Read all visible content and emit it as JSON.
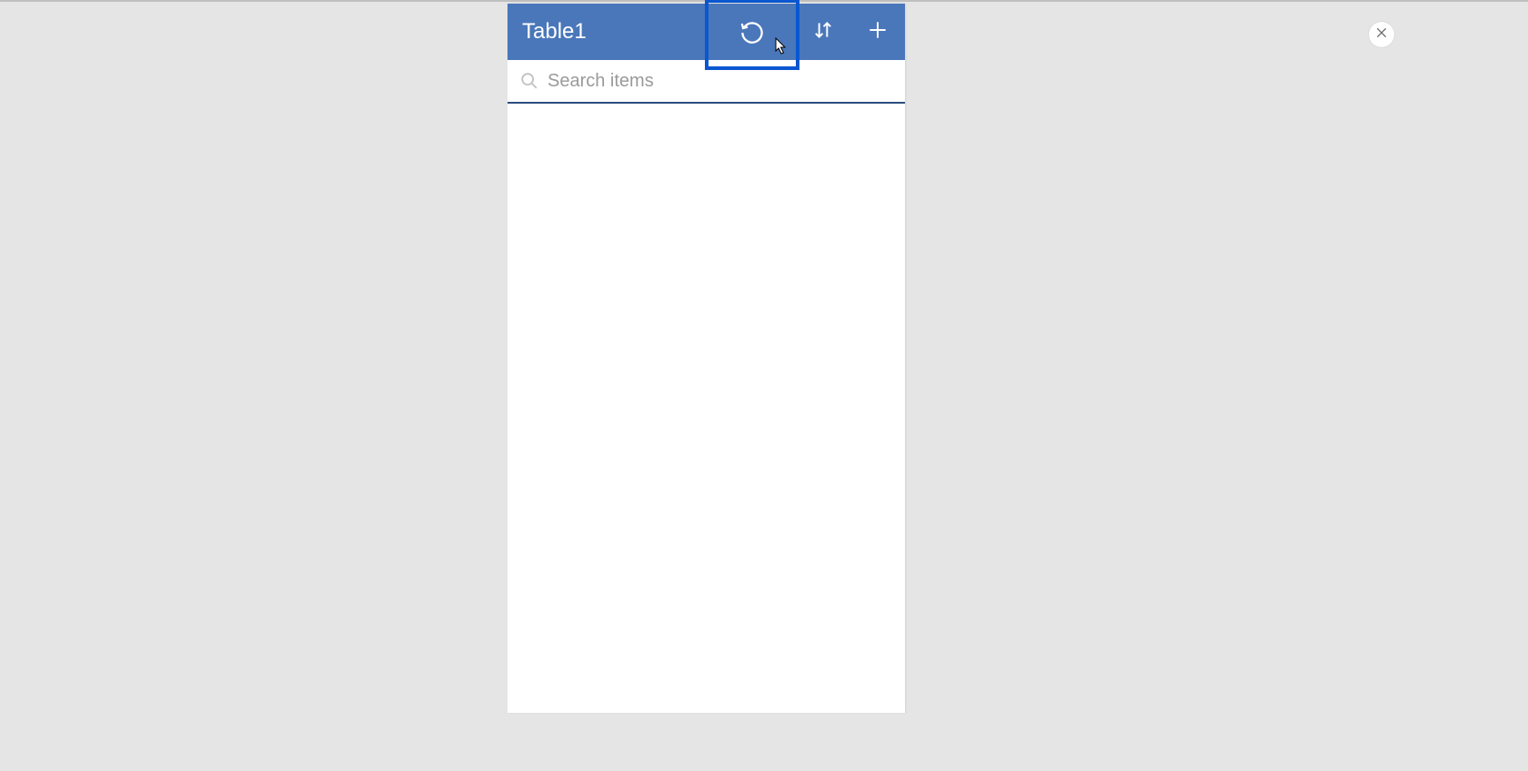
{
  "header": {
    "title": "Table1",
    "actions": {
      "refresh": "refresh",
      "sort": "sort",
      "add": "add"
    }
  },
  "search": {
    "placeholder": "Search items",
    "value": ""
  },
  "close": {
    "label": "close"
  },
  "colors": {
    "header_bg": "#4a77ba",
    "highlight": "#0a57d0",
    "underline": "#2b4d80"
  }
}
